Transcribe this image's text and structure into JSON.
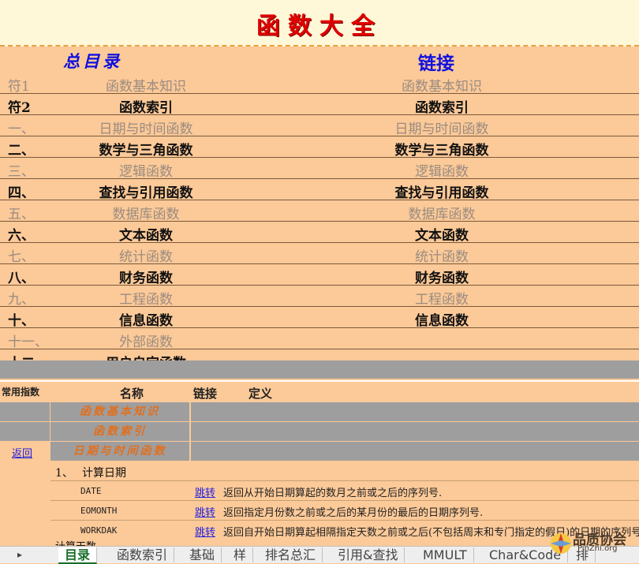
{
  "title": "函数大全",
  "header": {
    "toc_label": "总目录",
    "link_label": "链接"
  },
  "toc": [
    {
      "num": "符1",
      "name": "函数基本知识",
      "link": "函数基本知识",
      "state": "off"
    },
    {
      "num": "符2",
      "name": "函数索引",
      "link": "函数索引",
      "state": "on"
    },
    {
      "num": "一、",
      "name": "日期与时间函数",
      "link": "日期与时间函数",
      "state": "off"
    },
    {
      "num": "二、",
      "name": "数学与三角函数",
      "link": "数学与三角函数",
      "state": "on"
    },
    {
      "num": "三、",
      "name": "逻辑函数",
      "link": "逻辑函数",
      "state": "off"
    },
    {
      "num": "四、",
      "name": "查找与引用函数",
      "link": "查找与引用函数",
      "state": "on"
    },
    {
      "num": "五、",
      "name": "数据库函数",
      "link": "数据库函数",
      "state": "off"
    },
    {
      "num": "六、",
      "name": "文本函数",
      "link": "文本函数",
      "state": "on"
    },
    {
      "num": "七、",
      "name": "统计函数",
      "link": "统计函数",
      "state": "off"
    },
    {
      "num": "八、",
      "name": "财务函数",
      "link": "财务函数",
      "state": "on"
    },
    {
      "num": "九、",
      "name": "工程函数",
      "link": "工程函数",
      "state": "off"
    },
    {
      "num": "十、",
      "name": "信息函数",
      "link": "信息函数",
      "state": "on"
    },
    {
      "num": "十一、",
      "name": "外部函数",
      "link": "",
      "state": "off"
    },
    {
      "num": "十二、",
      "name": "用户自定函数",
      "link": "",
      "state": "on"
    }
  ],
  "sub_header": {
    "freq": "常用指数",
    "name": "名称",
    "link": "链接",
    "def": "定义"
  },
  "categories": [
    "函数基本知识",
    "函数索引",
    "日期与时间函数"
  ],
  "back_label": "返回",
  "section": {
    "num": "1、",
    "title": "计算日期"
  },
  "functions": [
    {
      "name": "DATE",
      "jump": "跳转",
      "def": "返回从开始日期算起的数月之前或之后的序列号."
    },
    {
      "name": "EOMONTH",
      "jump": "跳转",
      "def": "返回指定月份数之前或之后的某月份的最后的日期序列号."
    },
    {
      "name": "WORKDAK",
      "jump": "跳转",
      "def": "返回自开始日期算起相隔指定天数之前或之后(不包括周末和专门指定的假日)的日期的序列号"
    }
  ],
  "cut_section": "计算天数",
  "tabs": [
    "目录",
    "函数索引",
    "基础",
    "样",
    "排名总汇",
    "引用&查找",
    "MMULT",
    "Char&Code",
    "排"
  ],
  "active_tab": 0,
  "logo": {
    "text": "品质协会",
    "sub": "PinZhi.org"
  },
  "colors": {
    "background": "#fcc998",
    "title": "#e00000",
    "link_blue": "#1010e0",
    "band": "#9e9e9e"
  }
}
